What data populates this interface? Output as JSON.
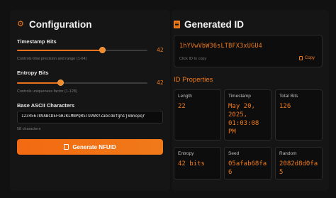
{
  "config": {
    "title": "Configuration",
    "timestamp": {
      "label": "Timestamp Bits",
      "value": "42",
      "hint": "Controls time precision and range (1-64)",
      "level_pct": 65
    },
    "entropy": {
      "label": "Entropy Bits",
      "value": "42",
      "hint": "Controls uniqueness factor (1-128)",
      "level_pct": 33
    },
    "ascii": {
      "label": "Base ASCII Characters",
      "value": "123456789ABCDEFGHJKLMNPQRSTUVWXYZabcdefghijkmnopqr",
      "count": "58 characters"
    },
    "generate_label": "Generate NFUID"
  },
  "generated": {
    "title": "Generated ID",
    "id": "1hYVwVbW36sLTBFX3xUGU4",
    "hint": "Click ID to copy",
    "copy_label": "Copy"
  },
  "properties": {
    "title": "ID Properties",
    "cards": [
      {
        "label": "Length",
        "value": "22"
      },
      {
        "label": "Timestamp",
        "value": "May 20,\n2025,\n01:03:08\nPM"
      },
      {
        "label": "Total Bits",
        "value": "126"
      },
      {
        "label": "Entropy",
        "value": "42 bits"
      },
      {
        "label": "Seed",
        "value": "05afab68fa\n6"
      },
      {
        "label": "Random",
        "value": "2082d8d0fa\n5"
      }
    ]
  },
  "colors": {
    "accent": "#f07a1a",
    "background": "#111111",
    "panel": "#151515"
  },
  "icons": {
    "config": "gear-icon",
    "generated": "document-icon",
    "button": "sparkle-icon",
    "copy": "copy-icon"
  }
}
